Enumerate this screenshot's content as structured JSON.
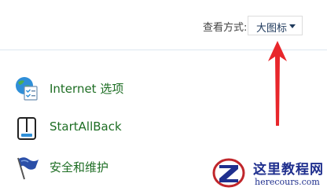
{
  "toolbar": {
    "view_by_label": "查看方式:",
    "view_by_value": "大图标"
  },
  "items": [
    {
      "label": "Internet 选项",
      "icon": "internet-options-icon"
    },
    {
      "label": "StartAllBack",
      "icon": "startallback-icon"
    },
    {
      "label": "安全和维护",
      "icon": "security-maintenance-flag-icon"
    }
  ],
  "annotation": {
    "icon": "red-arrow-icon",
    "color": "#e8262b"
  },
  "watermark": {
    "title": "这里教程网",
    "url": "herecours.com",
    "icon": "z-logo-icon"
  },
  "colors": {
    "link_green": "#1e6e24",
    "dropdown_text": "#1f3a5c",
    "watermark_blue": "#1f2f8e"
  }
}
